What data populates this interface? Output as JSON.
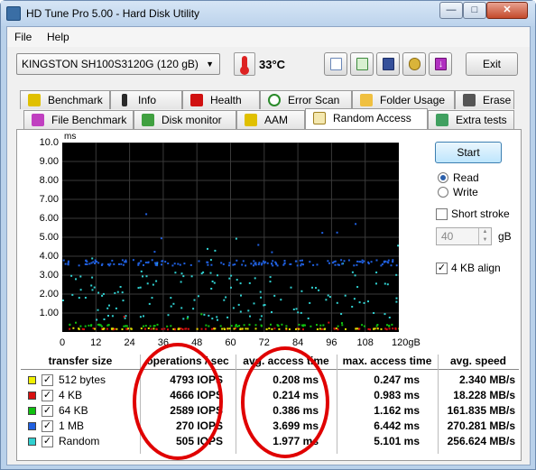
{
  "window": {
    "title": "HD Tune Pro 5.00 - Hard Disk Utility"
  },
  "menu": [
    {
      "label": "File"
    },
    {
      "label": "Help"
    }
  ],
  "toolbar": {
    "drive": "KINGSTON SH100S3120G (120 gB)",
    "temperature": "33°C",
    "exit_label": "Exit"
  },
  "tabs_row1": [
    {
      "label": "Benchmark",
      "icon": "benchmark-icon"
    },
    {
      "label": "Info",
      "icon": "info-icon"
    },
    {
      "label": "Health",
      "icon": "health-icon"
    },
    {
      "label": "Error Scan",
      "icon": "error-scan-icon"
    },
    {
      "label": "Folder Usage",
      "icon": "folder-icon"
    },
    {
      "label": "Erase",
      "icon": "erase-icon"
    }
  ],
  "tabs_row2": [
    {
      "label": "File Benchmark",
      "icon": "file-benchmark-icon"
    },
    {
      "label": "Disk monitor",
      "icon": "disk-monitor-icon"
    },
    {
      "label": "AAM",
      "icon": "aam-icon"
    },
    {
      "label": "Random Access",
      "icon": "random-access-icon"
    },
    {
      "label": "Extra tests",
      "icon": "extra-tests-icon"
    }
  ],
  "active_tab": "Random Access",
  "controls": {
    "start_label": "Start",
    "read_label": "Read",
    "write_label": "Write",
    "mode": "Read",
    "short_stroke_label": "Short stroke",
    "short_stroke_checked": false,
    "short_stroke_value": "40",
    "short_stroke_unit": "gB",
    "align_label": "4 KB align",
    "align_checked": true
  },
  "chart_data": {
    "type": "scatter",
    "ylabel": "ms",
    "xlabel": "",
    "y_ticks": [
      "10.0",
      "9.00",
      "8.00",
      "7.00",
      "6.00",
      "5.00",
      "4.00",
      "3.00",
      "2.00",
      "1.00"
    ],
    "x_ticks": [
      "0",
      "12",
      "24",
      "36",
      "48",
      "60",
      "72",
      "84",
      "96",
      "108",
      "120gB"
    ],
    "xlim": [
      0,
      120
    ],
    "ylim": [
      0,
      10
    ],
    "grid": true,
    "series": [
      {
        "name": "512 bytes",
        "color": "#e0e000",
        "y_center": 0.21,
        "y_spread": 0.02,
        "y_max": 0.25,
        "count": 60
      },
      {
        "name": "4 KB",
        "color": "#d81010",
        "y_center": 0.21,
        "y_spread": 0.03,
        "y_max": 0.98,
        "count": 60
      },
      {
        "name": "64 KB",
        "color": "#10c010",
        "y_center": 0.39,
        "y_spread": 0.05,
        "y_max": 1.16,
        "count": 70
      },
      {
        "name": "1 MB",
        "color": "#2060e0",
        "y_center": 3.7,
        "y_spread": 0.15,
        "y_max": 6.44,
        "count": 160
      },
      {
        "name": "Random",
        "color": "#30d0d0",
        "y_center": 1.98,
        "y_spread": 1.3,
        "y_max": 5.1,
        "count": 140
      }
    ]
  },
  "table": {
    "headers": [
      "transfer size",
      "operations / sec",
      "avg. access time",
      "max. access time",
      "avg. speed"
    ],
    "rows": [
      {
        "label": "512 bytes",
        "color": "#f0f000",
        "iops": "4793 IOPS",
        "avg": "0.208 ms",
        "max": "0.247 ms",
        "speed": "2.340 MB/s"
      },
      {
        "label": "4 KB",
        "color": "#d81010",
        "iops": "4666 IOPS",
        "avg": "0.214 ms",
        "max": "0.983 ms",
        "speed": "18.228 MB/s"
      },
      {
        "label": "64 KB",
        "color": "#10c010",
        "iops": "2589 IOPS",
        "avg": "0.386 ms",
        "max": "1.162 ms",
        "speed": "161.835 MB/s"
      },
      {
        "label": "1 MB",
        "color": "#2060e0",
        "iops": "270 IOPS",
        "avg": "3.699 ms",
        "max": "6.442 ms",
        "speed": "270.281 MB/s"
      },
      {
        "label": "Random",
        "color": "#30d0d0",
        "iops": "505 IOPS",
        "avg": "1.977 ms",
        "max": "5.101 ms",
        "speed": "256.624 MB/s"
      }
    ]
  }
}
